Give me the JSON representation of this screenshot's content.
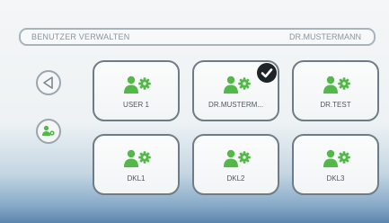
{
  "header": {
    "title": "BENUTZER VERWALTEN",
    "current_user": "DR.MUSTERMANN"
  },
  "side_buttons": [
    {
      "icon": "back-arrow-icon"
    },
    {
      "icon": "user-settings-icon"
    }
  ],
  "users": [
    {
      "label": "USER 1",
      "icon": "user-settings-icon",
      "selected": false
    },
    {
      "label": "DR.MUSTERM...",
      "icon": "user-settings-icon",
      "selected": true
    },
    {
      "label": "DR.TEST",
      "icon": "user-settings-icon",
      "selected": false
    },
    {
      "label": "DKL1",
      "icon": "user-settings-icon",
      "selected": false
    },
    {
      "label": "DKL2",
      "icon": "user-settings-icon",
      "selected": false
    },
    {
      "label": "DKL3",
      "icon": "user-settings-icon",
      "selected": false
    }
  ],
  "colors": {
    "user_icon": "#52b848",
    "tile_border": "#6f7c86",
    "check_badge": "#1e2427"
  }
}
